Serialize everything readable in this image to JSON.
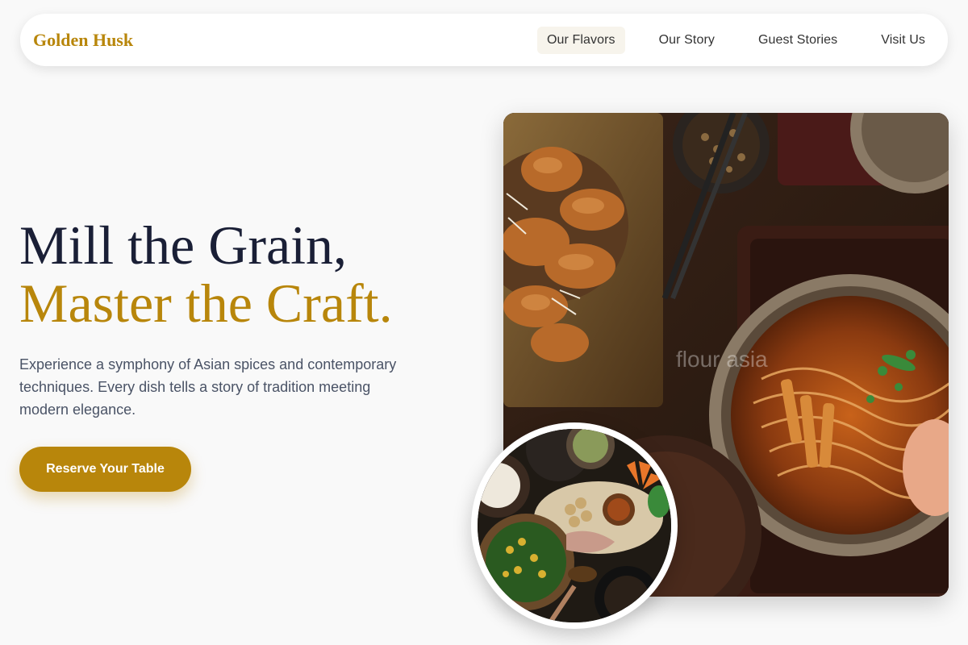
{
  "brand": {
    "name": "Golden Husk"
  },
  "nav": {
    "items": [
      {
        "label": "Our Flavors",
        "active": true
      },
      {
        "label": "Our Story",
        "active": false
      },
      {
        "label": "Guest Stories",
        "active": false
      },
      {
        "label": "Visit Us",
        "active": false
      }
    ]
  },
  "hero": {
    "title_line1": "Mill the Grain,",
    "title_line2": "Master the Craft.",
    "description": "Experience a symphony of Asian spices and contemporary techniques. Every dish tells a story of tradition meeting modern elegance.",
    "cta_label": "Reserve Your Table"
  },
  "images": {
    "main_watermark": "flour asia"
  },
  "colors": {
    "accent": "#b8860b",
    "heading": "#1a1f36",
    "body_text": "#4a5366",
    "background": "#f9f9f9"
  }
}
